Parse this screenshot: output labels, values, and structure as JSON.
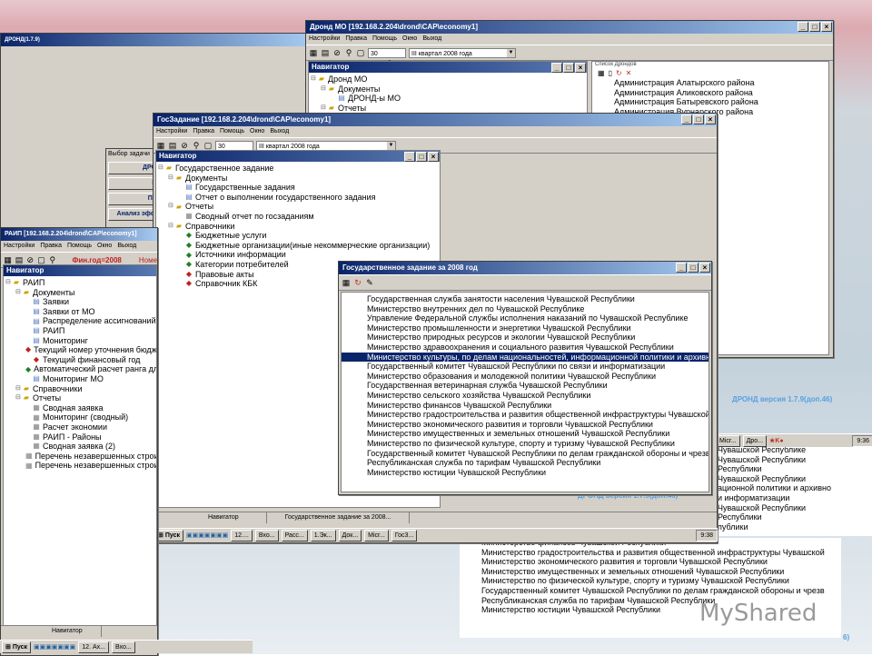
{
  "windows": {
    "drond": {
      "title": "Дронд МО [192.168.2.204\\drond\\CAP\\economy1]",
      "menu": [
        "Настройки",
        "Правка",
        "Помощь",
        "Окно",
        "Выход"
      ],
      "date": "30 сентября",
      "quarter": "III квартал 2008 года",
      "navigator_title": "Навигатор",
      "tree": [
        {
          "t": "Дронд МО",
          "i": "fld",
          "d": 0
        },
        {
          "t": "Документы",
          "i": "fld",
          "d": 1
        },
        {
          "t": "ДРОНД-ы МО",
          "i": "doc",
          "d": 2
        },
        {
          "t": "Отчеты",
          "i": "fld",
          "d": 1
        },
        {
          "t": "Сравнение Приложения 2 с Приложениями 4 и 5",
          "i": "rep",
          "d": 2
        }
      ],
      "list_title": "Список Дрондов",
      "list": [
        "Администрация Алатырского района",
        "Администрация Аликовского района",
        "Администрация Батыревского района",
        "Администрация Вурнарского района",
        "района",
        "района",
        "кого района",
        "ского района",
        "ского района",
        "осадского района",
        "района",
        "района",
        "района",
        "о района",
        "района",
        "района",
        "ого района",
        "ого района",
        "района",
        "района",
        "сарск"
      ],
      "version": "ДРОНД версия 1.7.9(доп.46)"
    },
    "left_partial": {
      "title": "ДРОНД(1.7.9)",
      "task_title": "Выбор задачи",
      "task_buttons": [
        "ДРО",
        "Р",
        "По",
        "Анализ эфф"
      ]
    },
    "gos": {
      "title": "ГосЗадание [192.168.2.204\\drond\\CAP\\economy1]",
      "menu": [
        "Настройки",
        "Правка",
        "Помощь",
        "Окно",
        "Выход"
      ],
      "date": "30 сентября",
      "quarter": "III квартал 2008 года",
      "navigator_title": "Навигатор",
      "tree": [
        {
          "t": "Государственное задание",
          "i": "fld",
          "d": 0
        },
        {
          "t": "Документы",
          "i": "fld",
          "d": 1
        },
        {
          "t": "Государственные задания",
          "i": "doc",
          "d": 2
        },
        {
          "t": "Отчет о выполнении государственного задания",
          "i": "doc",
          "d": 2
        },
        {
          "t": "Отчеты",
          "i": "fld",
          "d": 1
        },
        {
          "t": "Сводный отчет по госзаданиям",
          "i": "rep",
          "d": 2
        },
        {
          "t": "Справочники",
          "i": "fld",
          "d": 1
        },
        {
          "t": "Бюджетные услуги",
          "i": "gbook",
          "d": 2
        },
        {
          "t": "Бюджетные организации(иные некоммерческие организации)",
          "i": "gbook",
          "d": 2
        },
        {
          "t": "Источники информации",
          "i": "gbook",
          "d": 2
        },
        {
          "t": "Категории потребителей",
          "i": "gbook",
          "d": 2
        },
        {
          "t": "Правовые акты",
          "i": "rbook",
          "d": 2
        },
        {
          "t": "Справочник КБК",
          "i": "rbook",
          "d": 2
        }
      ],
      "status": [
        "Навигатор",
        "Государственное задание за 2008..."
      ],
      "version": "ДРОНД версия 1.7.9(доп.46)"
    },
    "raip": {
      "title": "РАИП [192.168.2.204\\drond\\CAP\\economy1]",
      "menu": [
        "Настройки",
        "Правка",
        "Помощь",
        "Окно",
        "Выход"
      ],
      "fin_year": "Фин.год=2008",
      "nom": "Номе",
      "navigator_title": "Навигатор",
      "tree": [
        {
          "t": "РАИП",
          "i": "fld",
          "d": 0
        },
        {
          "t": "Документы",
          "i": "fld",
          "d": 1
        },
        {
          "t": "Заявки",
          "i": "doc",
          "d": 2
        },
        {
          "t": "Заявки от МО",
          "i": "doc",
          "d": 2
        },
        {
          "t": "Распределение ассигнований",
          "i": "doc",
          "d": 2
        },
        {
          "t": "РАИП",
          "i": "doc",
          "d": 2
        },
        {
          "t": "Мониторинг",
          "i": "doc",
          "d": 2
        },
        {
          "t": "Текущий номер уточнения бюджета",
          "i": "rbook",
          "d": 2
        },
        {
          "t": "Текущий финансовый год",
          "i": "rbook",
          "d": 2
        },
        {
          "t": "Автоматический расчет ранга для во",
          "i": "gbook",
          "d": 2
        },
        {
          "t": "Мониторинг МО",
          "i": "doc",
          "d": 2
        },
        {
          "t": "Справочники",
          "i": "fld",
          "d": 1
        },
        {
          "t": "Отчеты",
          "i": "fld",
          "d": 1
        },
        {
          "t": "Сводная заявка",
          "i": "rep",
          "d": 2
        },
        {
          "t": "Мониторинг (сводный)",
          "i": "rep",
          "d": 2
        },
        {
          "t": "Расчет экономии",
          "i": "rep",
          "d": 2
        },
        {
          "t": "РАИП - Районы",
          "i": "rep",
          "d": 2
        },
        {
          "t": "Сводная заявка (2)",
          "i": "rep",
          "d": 2
        },
        {
          "t": "Перечень незавершенных строитель",
          "i": "rep",
          "d": 2
        },
        {
          "t": "Перечень незавершенных строитель",
          "i": "rep",
          "d": 2
        }
      ],
      "status": "Навигатор"
    },
    "gz2008": {
      "title": "Государственное задание за 2008 год",
      "list": [
        "Государственная служба занятости населения Чувашской Республики",
        "Министерство внутренних дел по Чувашской Республике",
        "Управление Федеральной службы исполнения наказаний по Чувашской Республике",
        "Министерство промышленности и энергетики Чувашской Республики",
        "Министерство природных ресурсов и экологии Чувашской Республики",
        "Министерство здравоохранения и социального развития Чувашской Республики",
        "Министерство культуры, по делам национальностей, информационной политики и архивного дел",
        "Государственный комитет Чувашской Республики по связи и информатизации",
        "Министерство образования и молодежной политики Чувашской Республики",
        "Государственная ветеринарная служба Чувашской Республики",
        "Министерство сельского хозяйства Чувашской Республики",
        "Министерство финансов Чувашской Республики",
        "Министерство градостроительства и развития общественной инфраструктуры Чувашской Респ",
        "Министерство экономического развития и торговли Чувашской Республики",
        "Министерство имущественных и земельных отношений Чувашской Республики",
        "Министерство по физической культуре, спорту и туризму Чувашской Республики",
        "Государственный комитет Чувашской Республики по делам гражданской обороны и чрезвычайн",
        "Республиканская служба по тарифам Чувашской Республики",
        "Министерство юстиции Чувашской Республики"
      ],
      "selected_index": 6
    },
    "back_right": {
      "rows": [
        "Чувашской Республике",
        "Чувашской Республики",
        "Республики",
        "Чувашской Республики",
        "ационной политики и архивно",
        "и информатизации",
        "Чувашской Республики",
        "Республики",
        "публики"
      ],
      "lower_rows": [
        "Министерство финансов Чувашской Республики",
        "Министерство градостроительства и развития общественной инфраструктуры Чувашской",
        "Министерство экономического развития и торговли Чувашской Республики",
        "Министерство имущественных и земельных отношений Чувашской Республики",
        "Министерство по физической культуре, спорту и туризму Чувашской Республики",
        "Государственный комитет Чувашской Республики по делам гражданской обороны и чрезв",
        "Республиканская служба по тарифам Чувашской Республики",
        "Министерство юстиции Чувашской Республики"
      ],
      "version_partial": "ДРОНД версия 1.7.9(доп.46)",
      "version_corner": "6)"
    }
  },
  "taskbars": {
    "top_right": {
      "items": [
        "Micr...",
        "Дро..."
      ],
      "clock": "9:36"
    },
    "middle": {
      "start": "Пуск",
      "items": [
        "12....",
        "Вхо...",
        "Расс...",
        "1.Эк...",
        "Док...",
        "Micr...",
        "Гос3..."
      ],
      "clock": "9:38"
    },
    "bottom": {
      "start": "Пуск",
      "items": [
        "12. Ах...",
        "Вхо..."
      ]
    }
  },
  "brand": "MyShared"
}
